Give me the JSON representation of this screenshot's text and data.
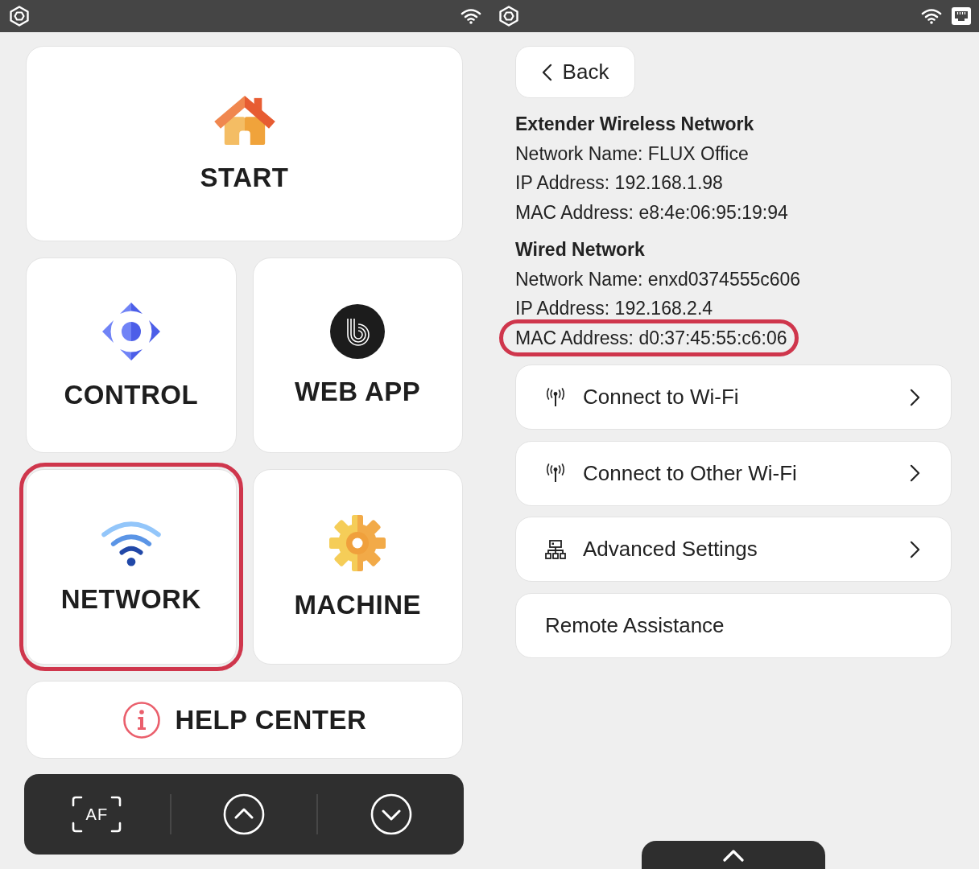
{
  "home_screen": {
    "tiles": [
      {
        "kind": "start",
        "label": "START",
        "highlighted": false
      },
      {
        "kind": "control",
        "label": "CONTROL",
        "highlighted": false
      },
      {
        "kind": "webapp",
        "label": "WEB APP",
        "highlighted": false
      },
      {
        "kind": "network",
        "label": "NETWORK",
        "highlighted": true
      },
      {
        "kind": "machine",
        "label": "MACHINE",
        "highlighted": false
      },
      {
        "kind": "help",
        "label": "HELP CENTER",
        "highlighted": false
      }
    ],
    "bottom_bar": {
      "focus_button": {
        "label": "AF"
      }
    }
  },
  "network_screen": {
    "back_button": {
      "label": "Back"
    },
    "sections": [
      {
        "title": "Extender Wireless Network",
        "lines": [
          {
            "text": "Network Name: FLUX Office",
            "highlighted": false
          },
          {
            "text": "IP Address: 192.168.1.98",
            "highlighted": false
          },
          {
            "text": "MAC Address: e8:4e:06:95:19:94",
            "highlighted": false
          }
        ]
      },
      {
        "title": "Wired Network",
        "lines": [
          {
            "text": "Network Name: enxd0374555c606",
            "highlighted": false
          },
          {
            "text": "IP Address: 192.168.2.4",
            "highlighted": false
          },
          {
            "text": "MAC Address: d0:37:45:55:c6:06",
            "highlighted": true
          }
        ]
      }
    ],
    "menu": [
      {
        "kind": "antenna",
        "label": "Connect to Wi-Fi",
        "arrow": true
      },
      {
        "kind": "antenna",
        "label": "Connect to Other Wi-Fi",
        "arrow": true
      },
      {
        "kind": "sitemap",
        "label": "Advanced Settings",
        "arrow": true
      },
      {
        "kind": "plain",
        "label": "Remote Assistance",
        "arrow": false
      }
    ]
  }
}
